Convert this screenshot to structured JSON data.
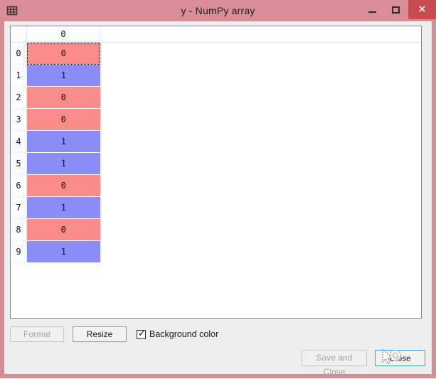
{
  "window": {
    "title": "y - NumPy array",
    "icon": "table-grid-icon",
    "accent_color": "#d98d96",
    "close_button_color": "#c74b4f",
    "controls": {
      "minimize": "minimize-icon",
      "maximize": "maximize-icon",
      "close": "✕"
    }
  },
  "table": {
    "corner_label": "",
    "column_headers": [
      "0"
    ],
    "row_headers": [
      "0",
      "1",
      "2",
      "3",
      "4",
      "5",
      "6",
      "7",
      "8",
      "9"
    ],
    "rows": [
      {
        "index": "0",
        "value": "0",
        "color": "#fa8c8c",
        "selected": true
      },
      {
        "index": "1",
        "value": "1",
        "color": "#8c8cf8",
        "selected": false
      },
      {
        "index": "2",
        "value": "0",
        "color": "#fa8c8c",
        "selected": false
      },
      {
        "index": "3",
        "value": "0",
        "color": "#fa8c8c",
        "selected": false
      },
      {
        "index": "4",
        "value": "1",
        "color": "#8c8cf8",
        "selected": false
      },
      {
        "index": "5",
        "value": "1",
        "color": "#8c8cf8",
        "selected": false
      },
      {
        "index": "6",
        "value": "0",
        "color": "#fa8c8c",
        "selected": false
      },
      {
        "index": "7",
        "value": "1",
        "color": "#8c8cf8",
        "selected": false
      },
      {
        "index": "8",
        "value": "0",
        "color": "#fa8c8c",
        "selected": false
      },
      {
        "index": "9",
        "value": "1",
        "color": "#8c8cf8",
        "selected": false
      }
    ],
    "value_zero_color": "#fa8c8c",
    "value_one_color": "#8c8cf8"
  },
  "controls": {
    "format_label": "Format",
    "format_enabled": false,
    "resize_label": "Resize",
    "resize_enabled": true,
    "background_color_label": "Background color",
    "background_color_checked": true
  },
  "footer": {
    "save_and_close_label": "Save and Close",
    "save_and_close_enabled": false,
    "close_label": "Close",
    "close_focused": true,
    "cursor": "busy-cursor"
  }
}
